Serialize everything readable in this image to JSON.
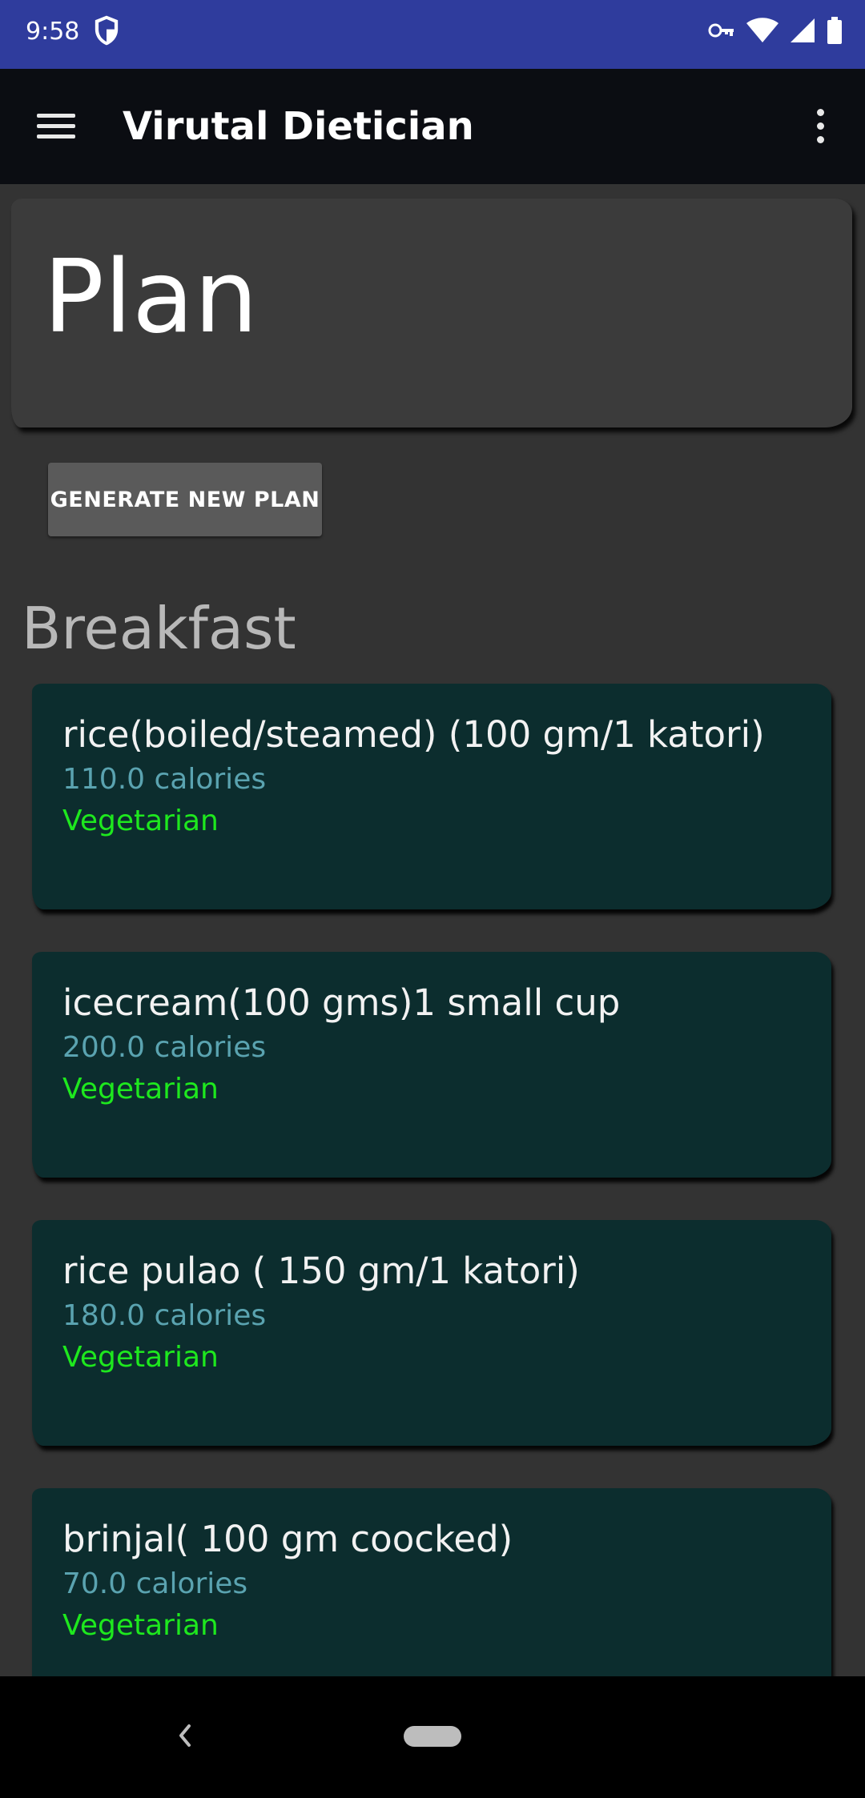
{
  "status_bar": {
    "time": "9:58",
    "icons": [
      "shield-icon",
      "vpn-key-icon",
      "wifi-icon",
      "signal-icon",
      "battery-icon"
    ]
  },
  "toolbar": {
    "title": "Virutal Dietician",
    "menu_icon": "hamburger-menu-icon",
    "overflow_icon": "more-vert-icon"
  },
  "plan": {
    "title": "Plan",
    "generate_button_label": "GENERATE NEW PLAN"
  },
  "section": {
    "title": "Breakfast"
  },
  "foods": [
    {
      "name": "rice(boiled/steamed) (100 gm/1 katori)",
      "calories": "110.0 calories",
      "type": "Vegetarian"
    },
    {
      "name": "icecream(100 gms)1 small cup",
      "calories": "200.0 calories",
      "type": "Vegetarian"
    },
    {
      "name": "rice pulao ( 150 gm/1 katori)",
      "calories": "180.0 calories",
      "type": "Vegetarian"
    },
    {
      "name": "brinjal( 100 gm coocked)",
      "calories": "70.0 calories",
      "type": "Vegetarian"
    }
  ],
  "colors": {
    "status_bar": "#2f3c9d",
    "toolbar": "#0b0d12",
    "background": "#333333",
    "card": "#0c2d2e",
    "calories_text": "#5aa3b0",
    "vegetarian_text": "#1ee81e"
  },
  "nav_bar": {
    "icons": [
      "back-icon",
      "home-pill-icon"
    ]
  }
}
